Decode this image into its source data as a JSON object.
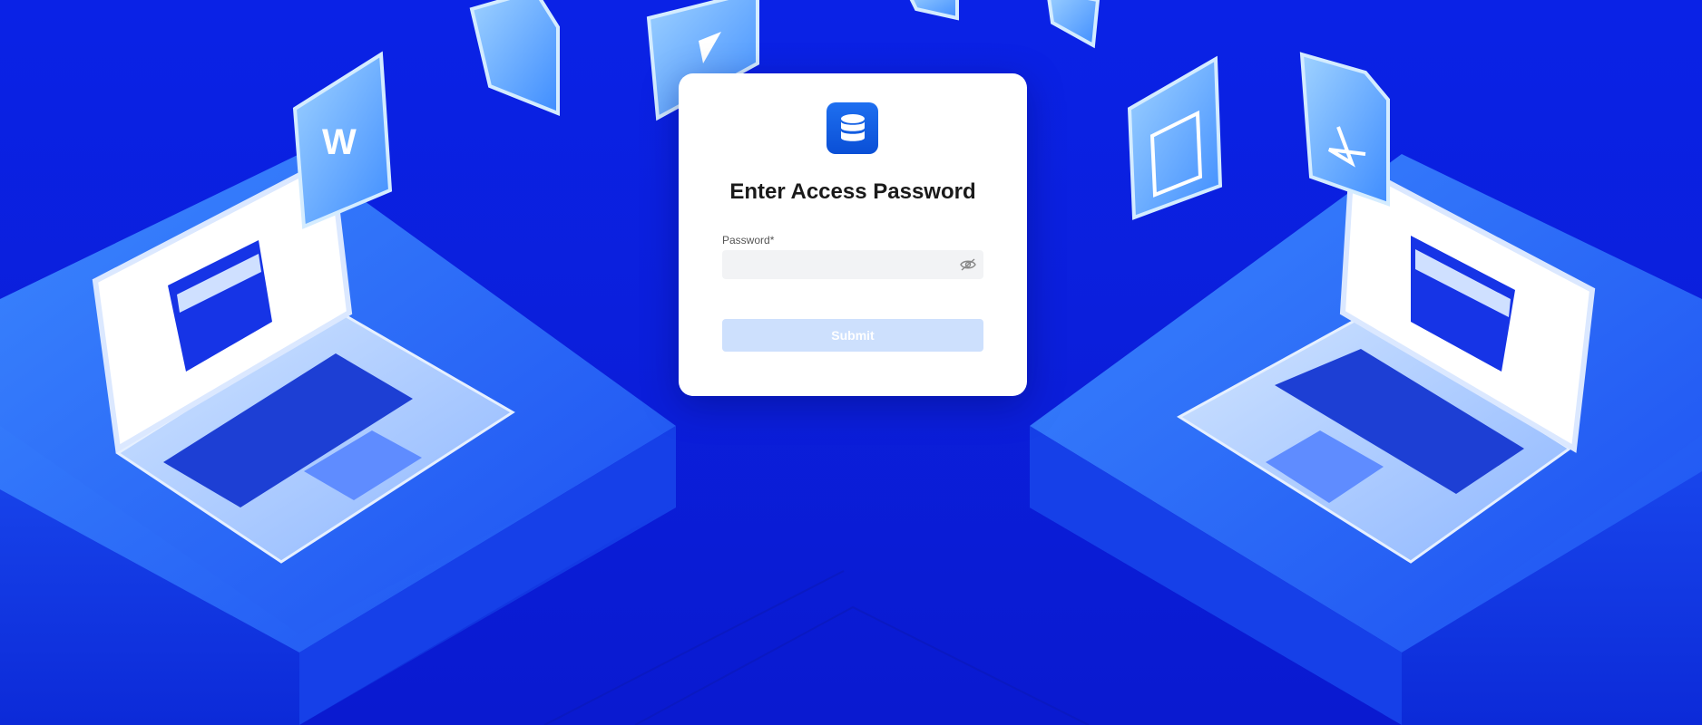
{
  "dialog": {
    "title": "Enter Access Password",
    "logo_icon": "database-icon"
  },
  "password": {
    "label": "Password",
    "required_marker": "*",
    "value": "",
    "placeholder": "",
    "toggle_icon": "eye-off-icon"
  },
  "submit": {
    "label": "Submit",
    "state": "disabled"
  },
  "colors": {
    "background": "#0b1fdc",
    "accent": "#1e6ff0",
    "submit_disabled": "#cde0fd"
  }
}
